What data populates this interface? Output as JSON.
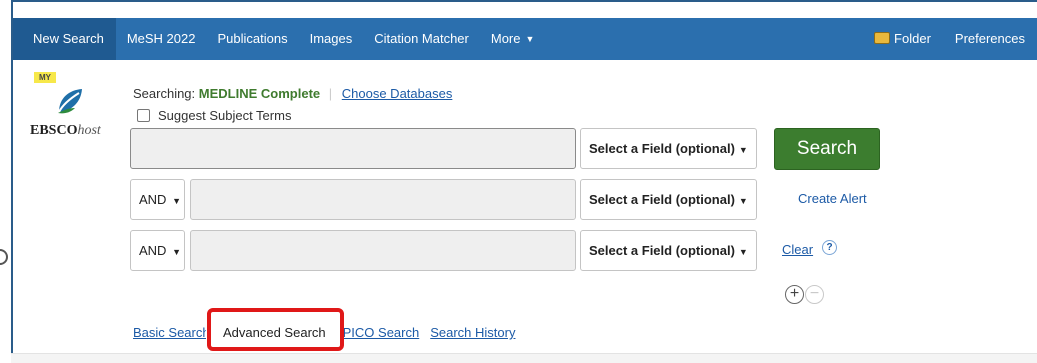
{
  "nav": {
    "items": [
      "New Search",
      "MeSH 2022",
      "Publications",
      "Images",
      "Citation Matcher",
      "More"
    ],
    "right_items": [
      "Folder",
      "Preferences"
    ],
    "brand_color": "#2b6fae"
  },
  "logo": {
    "badge": "MY",
    "brand_main": "EBSCO",
    "brand_suffix": "host"
  },
  "searching": {
    "prefix": "Searching:",
    "database": "MEDLINE Complete",
    "choose_link": "Choose Databases"
  },
  "suggest_subject": {
    "label": "Suggest Subject Terms",
    "checked": false
  },
  "search_rows": [
    {
      "operator": null,
      "value": "",
      "field": "Select a Field (optional)"
    },
    {
      "operator": "AND",
      "value": "",
      "field": "Select a Field (optional)"
    },
    {
      "operator": "AND",
      "value": "",
      "field": "Select a Field (optional)"
    }
  ],
  "actions": {
    "search_label": "Search",
    "create_alert": "Create Alert",
    "clear": "Clear",
    "help": "?",
    "add_row": "+",
    "remove_row": "−"
  },
  "bottom_links": {
    "basic": "Basic Search",
    "advanced": "Advanced Search",
    "pico": "PICO Search",
    "history": "Search History"
  },
  "colors": {
    "accent_green": "#3c7d2f",
    "link_blue": "#1c5aa6",
    "highlight_red": "#e01818"
  }
}
